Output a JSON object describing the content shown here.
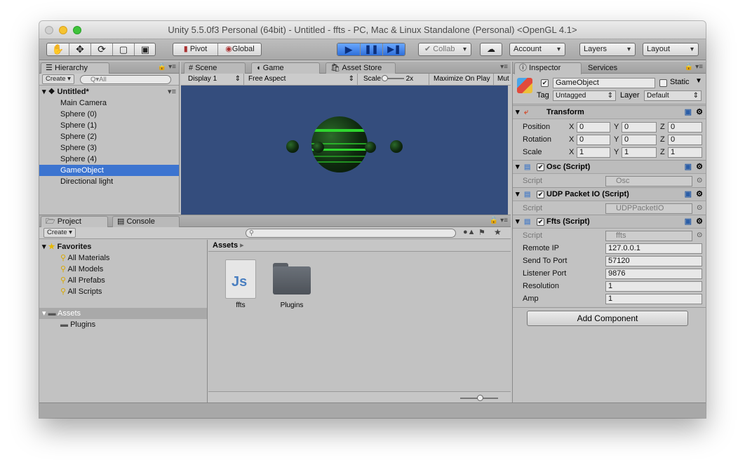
{
  "window": {
    "title": "Unity 5.5.0f3 Personal (64bit) - Untitled - ffts - PC, Mac & Linux Standalone (Personal) <OpenGL 4.1>"
  },
  "toolbar": {
    "pivot": "Pivot",
    "global": "Global",
    "collab": "Collab",
    "account": "Account",
    "layers": "Layers",
    "layout": "Layout"
  },
  "hierarchy": {
    "tab": "Hierarchy",
    "create": "Create",
    "search_placeholder": "Q▾All",
    "scene": "Untitled*",
    "items": [
      "Main Camera",
      "Sphere (0)",
      "Sphere (1)",
      "Sphere (2)",
      "Sphere (3)",
      "Sphere (4)",
      "GameObject",
      "Directional light"
    ],
    "selected": "GameObject"
  },
  "center_tabs": {
    "scene": "Scene",
    "game": "Game",
    "asset_store": "Asset Store"
  },
  "game_bar": {
    "display": "Display 1",
    "aspect": "Free Aspect",
    "scale_label": "Scale",
    "scale_value": "2x",
    "maximize": "Maximize On Play",
    "mute": "Mut"
  },
  "project": {
    "tab": "Project",
    "console_tab": "Console",
    "create": "Create",
    "favorites": "Favorites",
    "fav_items": [
      "All Materials",
      "All Models",
      "All Prefabs",
      "All Scripts"
    ],
    "assets": "Assets",
    "asset_children": [
      "Plugins"
    ],
    "breadcrumb": "Assets",
    "files": [
      {
        "name": "ffts",
        "icon": "js-file-icon"
      },
      {
        "name": "Plugins",
        "icon": "folder-icon"
      }
    ]
  },
  "inspector": {
    "tab": "Inspector",
    "services_tab": "Services",
    "object_name": "GameObject",
    "static_label": "Static",
    "tag_label": "Tag",
    "tag_value": "Untagged",
    "layer_label": "Layer",
    "layer_value": "Default",
    "transform": {
      "title": "Transform",
      "rows": [
        {
          "label": "Position",
          "x": "0",
          "y": "0",
          "z": "0"
        },
        {
          "label": "Rotation",
          "x": "0",
          "y": "0",
          "z": "0"
        },
        {
          "label": "Scale",
          "x": "1",
          "y": "1",
          "z": "1"
        }
      ]
    },
    "components": [
      {
        "title": "Osc (Script)",
        "script_label": "Script",
        "script": "Osc"
      },
      {
        "title": "UDP Packet IO (Script)",
        "script_label": "Script",
        "script": "UDPPacketIO"
      },
      {
        "title": "Ffts (Script)",
        "script_label": "Script",
        "script": "ffts"
      }
    ],
    "ffts_fields": [
      {
        "label": "Remote IP",
        "value": "127.0.0.1"
      },
      {
        "label": "Send To Port",
        "value": "57120"
      },
      {
        "label": "Listener Port",
        "value": "9876"
      },
      {
        "label": "Resolution",
        "value": "1"
      },
      {
        "label": "Amp",
        "value": "1"
      }
    ],
    "add_component": "Add Component"
  },
  "colors": {
    "selection": "#3c74d0",
    "play_button": "#2f6fd9",
    "game_background": "#344d7d",
    "sphere_stripe": "#2fd62f"
  }
}
